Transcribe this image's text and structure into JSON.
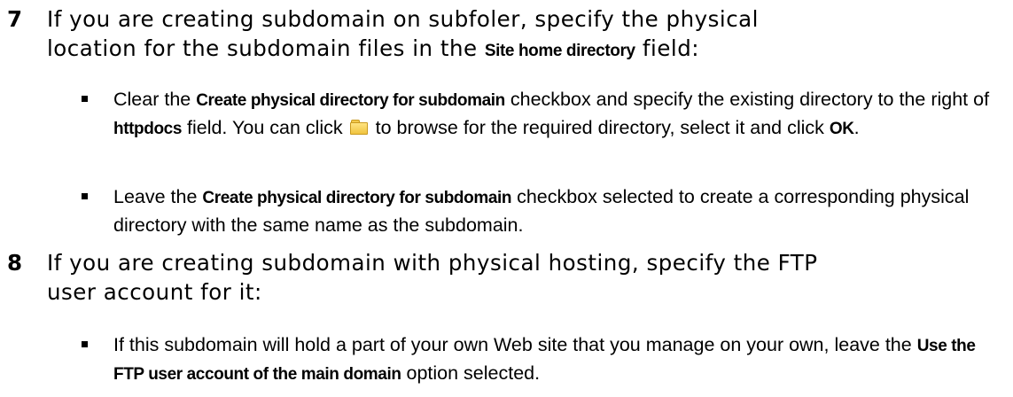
{
  "step7": {
    "number": "7",
    "line1": "If you are creating subdomain on subfoler, specify the physical",
    "line2_pre": "location for the subdomain files in the ",
    "line2_ui": "Site home directory",
    "line2_post": " field:"
  },
  "step7_bullet1": {
    "pre": "Clear the ",
    "ui1": "Create physical directory for subdomain",
    "mid1": " checkbox and specify the existing directory to the right of ",
    "ui2": "httpdocs",
    "mid2": " field. You can click ",
    "icon": "folder-icon",
    "mid3": " to browse for the required directory, select it and click ",
    "ui3": "OK",
    "post": "."
  },
  "step7_bullet2": {
    "pre": "Leave the ",
    "ui": "Create physical directory for subdomain",
    "post": " checkbox selected to create a corresponding physical directory with the same name as the subdomain."
  },
  "step8": {
    "number": "8",
    "line1": "If you are creating subdomain with physical hosting, specify the FTP",
    "line2": "user account for it:"
  },
  "step8_bullet1": {
    "pre": "If this subdomain will hold a part of your own Web site that you manage on your own, leave the ",
    "ui": "Use the FTP user account of the main domain",
    "post": " option selected."
  }
}
